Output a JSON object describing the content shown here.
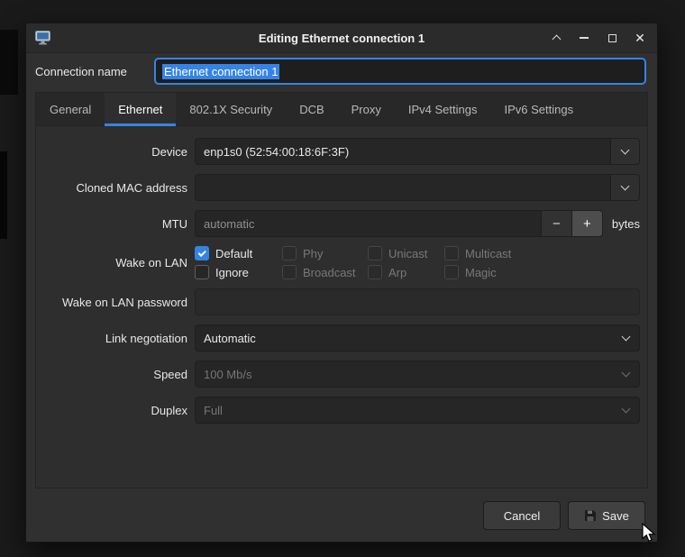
{
  "window": {
    "title": "Editing Ethernet connection 1",
    "controls": {
      "close_glyph": "✕"
    }
  },
  "connection": {
    "label": "Connection name",
    "value": "Ethernet connection 1"
  },
  "tabs": [
    {
      "label": "General",
      "active": false
    },
    {
      "label": "Ethernet",
      "active": true
    },
    {
      "label": "802.1X Security",
      "active": false
    },
    {
      "label": "DCB",
      "active": false
    },
    {
      "label": "Proxy",
      "active": false
    },
    {
      "label": "IPv4 Settings",
      "active": false
    },
    {
      "label": "IPv6 Settings",
      "active": false
    }
  ],
  "form": {
    "device": {
      "label": "Device",
      "value": "enp1s0 (52:54:00:18:6F:3F)"
    },
    "cloned_mac": {
      "label": "Cloned MAC address",
      "value": ""
    },
    "mtu": {
      "label": "MTU",
      "value": "automatic",
      "decrement": "−",
      "increment": "+",
      "unit": "bytes"
    },
    "wake_on_lan": {
      "label": "Wake on LAN",
      "options": [
        {
          "label": "Default",
          "checked": true,
          "enabled": true
        },
        {
          "label": "Phy",
          "checked": false,
          "enabled": false
        },
        {
          "label": "Unicast",
          "checked": false,
          "enabled": false
        },
        {
          "label": "Multicast",
          "checked": false,
          "enabled": false
        },
        {
          "label": "Ignore",
          "checked": false,
          "enabled": true
        },
        {
          "label": "Broadcast",
          "checked": false,
          "enabled": false
        },
        {
          "label": "Arp",
          "checked": false,
          "enabled": false
        },
        {
          "label": "Magic",
          "checked": false,
          "enabled": false
        }
      ]
    },
    "wol_password": {
      "label": "Wake on LAN password",
      "value": ""
    },
    "link_negotiation": {
      "label": "Link negotiation",
      "value": "Automatic",
      "enabled": true
    },
    "speed": {
      "label": "Speed",
      "value": "100 Mb/s",
      "enabled": false
    },
    "duplex": {
      "label": "Duplex",
      "value": "Full",
      "enabled": false
    }
  },
  "actions": {
    "cancel": "Cancel",
    "save": "Save"
  },
  "colors": {
    "accent": "#3584e4",
    "selection": "#3584e4"
  }
}
